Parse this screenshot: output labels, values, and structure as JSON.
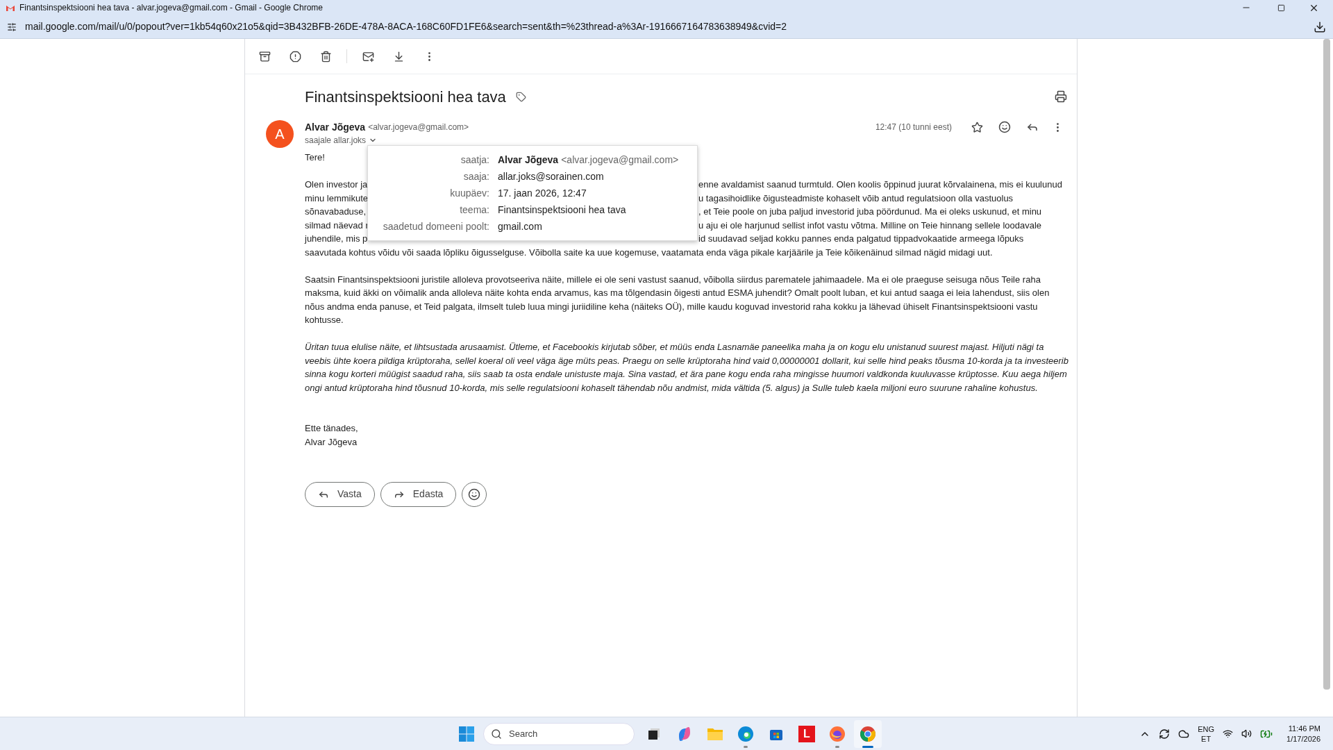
{
  "browser": {
    "tab_title": "Finantsinspektsiooni hea tava - alvar.jogeva@gmail.com - Gmail - Google Chrome",
    "url": "mail.google.com/mail/u/0/popout?ver=1kb54q60x21o5&qid=3B432BFB-26DE-478A-8ACA-168C60FD1FE6&search=sent&th=%23thread-a%3Ar-1916667164783638949&cvid=2"
  },
  "email": {
    "subject": "Finantsinspektsiooni hea tava",
    "sender_name": "Alvar Jõgeva",
    "sender_email": "<alvar.jogeva@gmail.com>",
    "avatar": "A",
    "recipients": "saajale allar.joks",
    "time": "12:47 (10 tunni eest)",
    "starred": false,
    "greeting": "Tere!",
    "paragraph_lines": [
      {
        "kind": "split",
        "left": "Olen investor ja",
        "right": "enne avaldamist saanud turmtuld. Olen koolis õppinud juurat kõrvalainena, mis ei kuulunud"
      },
      {
        "kind": "split",
        "left": "minu lemmikute",
        "right": "u tagasihoidlike õigusteadmiste kohaselt võib antud regulatsioon olla vastuolus"
      },
      {
        "kind": "split",
        "left": "sõnavabaduse,",
        "right": ", et Teie poole on juba paljud investorid juba pöördunud. Ma ei oleks uskunud, et minu"
      },
      {
        "kind": "split",
        "left": "silmad näevad r",
        "right": "u aju ei ole harjunud sellist infot vastu võtma. Milline on Teie hinnang sellele loodavale"
      },
      {
        "kind": "split",
        "left": "juhendile, mis p",
        "right": "id suudavad seljad kokku pannes enda palgatud tippadvokaatide armeega lõpuks"
      },
      {
        "kind": "full",
        "left": "saavutada kohtus võidu või saada lõpliku õigusselguse. Võibolla saite ka uue kogemuse, vaatamata enda väga pikale karjäärile ja Teie kõikenäinud silmad nägid midagi uut."
      }
    ],
    "paragraphs": [
      {
        "kind": "plain",
        "text": "Saatsin Finantsinspektsiooni juristile alloleva provotseeriva näite, millele ei ole seni vastust saanud, võibolla siirdus parematele jahimaadele. Ma ei ole praeguse seisuga nõus Teile raha maksma, kuid äkki on võimalik anda alloleva näite kohta enda arvamus, kas ma tõlgendasin õigesti antud ESMA juhendit? Omalt poolt luban, et kui antud saaga ei leia lahendust, siis olen nõus andma enda panuse, et Teid palgata, ilmselt tuleb luua mingi juriidiline keha (näiteks OÜ), mille kaudu koguvad investorid raha kokku ja lähevad ühiselt Finantsinspektsiooni vastu kohtusse."
      },
      {
        "kind": "italic",
        "text": "Üritan tuua elulise näite, et lihtsustada arusaamist. Ütleme, et Facebookis kirjutab sõber, et müüs enda Lasnamäe paneelika maha ja on kogu elu unistanud suurest majast. Hiljuti nägi ta veebis ühte koera pildiga krüptoraha, sellel koeral oli veel väga äge müts peas. Praegu on selle krüptoraha hind vaid 0,00000001 dollarit, kui selle hind peaks tõusma 10-korda ja ta investeerib sinna kogu korteri müügist saadud raha, siis saab ta osta endale unistuste maja. Sina vastad, et ära pane kogu enda raha mingisse huumori valdkonda kuuluvasse krüptosse. Kuu aega hiljem ongi antud krüptoraha hind tõusnud 10-korda, mis selle regulatsiooni kohaselt tähendab nõu andmist, mida vältida (5. algus) ja Sulle tuleb kaela miljoni euro suurune rahaline kohustus."
      }
    ],
    "signoff": [
      "Ette tänades,",
      "Alvar Jõgeva"
    ],
    "actions": [
      {
        "kind": "reply",
        "label": "Vasta"
      },
      {
        "kind": "forward",
        "label": "Edasta"
      }
    ],
    "details_popup": [
      {
        "label": "saatja:",
        "value": "Alvar Jõgeva",
        "note": "<alvar.jogeva@gmail.com>"
      },
      {
        "label": "saaja:",
        "value": "allar.joks@sorainen.com"
      },
      {
        "label": "kuupäev:",
        "value": "17. jaan 2026, 12:47"
      },
      {
        "label": "teema:",
        "value": "Finantsinspektsiooni hea tava"
      },
      {
        "label": "saadetud domeeni poolt:",
        "value": "gmail.com"
      }
    ]
  },
  "taskbar": {
    "search_placeholder": "Search",
    "apps": [
      {
        "kind": "taskview",
        "running": false,
        "selected": false
      },
      {
        "kind": "copilot",
        "running": false,
        "selected": false
      },
      {
        "kind": "explorer",
        "running": false,
        "selected": false
      },
      {
        "kind": "edge",
        "running": true,
        "selected": false
      },
      {
        "kind": "store",
        "running": false,
        "selected": false
      },
      {
        "kind": "letter",
        "label": "L",
        "running": false,
        "selected": false
      },
      {
        "kind": "firefox",
        "running": true,
        "selected": false
      },
      {
        "kind": "chrome",
        "running": true,
        "selected": true
      }
    ],
    "language": "ENG",
    "layout": "ET",
    "time": "11:46 PM",
    "date": "1/17/2026"
  }
}
